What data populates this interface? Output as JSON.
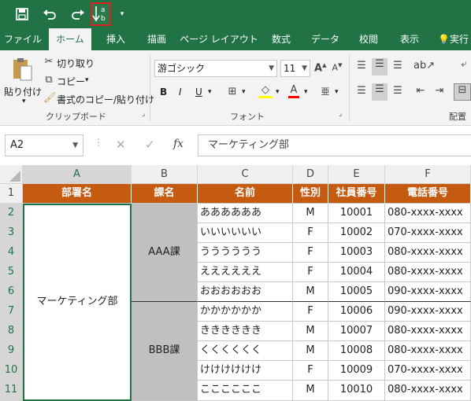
{
  "qat": {
    "save_icon": "save-icon",
    "undo_icon": "undo-icon",
    "redo_icon": "redo-icon",
    "sort_icon": "sort-ascending-icon",
    "sort_glyph": "↓ᵃᵦ"
  },
  "tabs": [
    "ファイル",
    "ホーム",
    "挿入",
    "描画",
    "ページ レイアウト",
    "数式",
    "データ",
    "校閲",
    "表示",
    "実行"
  ],
  "active_tab": "ホーム",
  "ribbon": {
    "paste": "貼り付け",
    "cut": "切り取り",
    "copy": "コピー",
    "format_painter": "書式のコピー/貼り付け",
    "clipboard_group": "クリップボード",
    "font_name": "游ゴシック",
    "font_size": "11",
    "font_group": "フォント",
    "bold": "B",
    "italic": "I",
    "underline": "U",
    "align_group": "配置"
  },
  "formula_bar": {
    "name_box": "A2",
    "cancel": "✕",
    "enter": "✓",
    "fx": "fx",
    "content": "マーケティング部"
  },
  "columns": [
    "A",
    "B",
    "C",
    "D",
    "E",
    "F"
  ],
  "rows": [
    "1",
    "2",
    "3",
    "4",
    "5",
    "6",
    "7",
    "8",
    "9",
    "10",
    "11"
  ],
  "table": {
    "headers": [
      "部署名",
      "課名",
      "名前",
      "性別",
      "社員番号",
      "電話番号"
    ],
    "department": "マーケティング部",
    "section_a": "AAA課",
    "section_b": "BBB課",
    "records": [
      [
        "ああああああ",
        "M",
        "10001",
        "080-xxxx-xxxx"
      ],
      [
        "いいいいいい",
        "F",
        "10002",
        "070-xxxx-xxxx"
      ],
      [
        "うううううう",
        "F",
        "10003",
        "080-xxxx-xxxx"
      ],
      [
        "ええええええ",
        "F",
        "10004",
        "080-xxxx-xxxx"
      ],
      [
        "おおおおおお",
        "M",
        "10005",
        "090-xxxx-xxxx"
      ],
      [
        "かかかかかか",
        "F",
        "10006",
        "090-xxxx-xxxx"
      ],
      [
        "きききききき",
        "M",
        "10007",
        "080-xxxx-xxxx"
      ],
      [
        "くくくくくく",
        "M",
        "10008",
        "080-xxxx-xxxx"
      ],
      [
        "けけけけけけ",
        "F",
        "10009",
        "070-xxxx-xxxx"
      ],
      [
        "ここここここ",
        "M",
        "10010",
        "080-xxxx-xxxx"
      ]
    ]
  },
  "colors": {
    "excel_green": "#217346",
    "header_fill": "#c55a11",
    "section_fill": "#c0c0c0",
    "highlight_border": "#e02020"
  }
}
